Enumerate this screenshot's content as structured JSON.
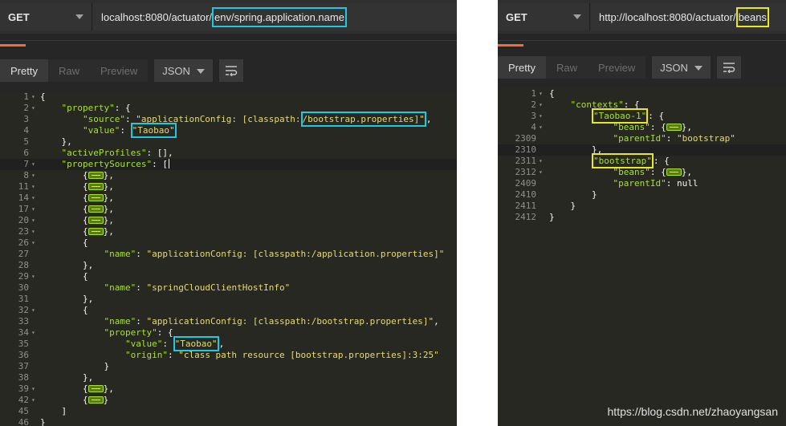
{
  "left": {
    "method": "GET",
    "url_prefix": "localhost:8080/actuator/",
    "url_highlight": "env/spring.application.name",
    "tabs": {
      "pretty": "Pretty",
      "raw": "Raw",
      "preview": "Preview"
    },
    "format": "JSON",
    "lines": [
      {
        "n": "1",
        "fold": true,
        "t": [
          [
            "p",
            "{"
          ]
        ]
      },
      {
        "n": "2",
        "fold": true,
        "t": [
          [
            "p",
            "    "
          ],
          [
            "k",
            "\"property\""
          ],
          [
            "p",
            ": {"
          ]
        ]
      },
      {
        "n": "3",
        "t": [
          [
            "p",
            "        "
          ],
          [
            "k",
            "\"source\""
          ],
          [
            "p",
            ": "
          ],
          [
            "s",
            "\"applicationConfig: [classpath:"
          ],
          [
            "sC",
            "/bootstrap.properties]\""
          ],
          [
            "p",
            ","
          ]
        ]
      },
      {
        "n": "4",
        "t": [
          [
            "p",
            "        "
          ],
          [
            "k",
            "\"value\""
          ],
          [
            "p",
            ": "
          ],
          [
            "sC",
            "\"Taobao\""
          ]
        ]
      },
      {
        "n": "5",
        "t": [
          [
            "p",
            "    },"
          ]
        ]
      },
      {
        "n": "6",
        "t": [
          [
            "p",
            "    "
          ],
          [
            "k",
            "\"activeProfiles\""
          ],
          [
            "p",
            ": [],"
          ]
        ]
      },
      {
        "n": "7",
        "fold": true,
        "cur": true,
        "t": [
          [
            "p",
            "    "
          ],
          [
            "k",
            "\"propertySources\""
          ],
          [
            "p",
            ": ["
          ],
          [
            "cur",
            ""
          ]
        ]
      },
      {
        "n": "8",
        "fold": true,
        "t": [
          [
            "p",
            "        {"
          ],
          [
            "fw",
            ""
          ],
          [
            "p",
            "},"
          ]
        ]
      },
      {
        "n": "11",
        "fold": true,
        "t": [
          [
            "p",
            "        {"
          ],
          [
            "fw",
            ""
          ],
          [
            "p",
            "},"
          ]
        ]
      },
      {
        "n": "14",
        "fold": true,
        "t": [
          [
            "p",
            "        {"
          ],
          [
            "fw",
            ""
          ],
          [
            "p",
            "},"
          ]
        ]
      },
      {
        "n": "17",
        "fold": true,
        "t": [
          [
            "p",
            "        {"
          ],
          [
            "fw",
            ""
          ],
          [
            "p",
            "},"
          ]
        ]
      },
      {
        "n": "20",
        "fold": true,
        "t": [
          [
            "p",
            "        {"
          ],
          [
            "fw",
            ""
          ],
          [
            "p",
            "},"
          ]
        ]
      },
      {
        "n": "23",
        "fold": true,
        "t": [
          [
            "p",
            "        {"
          ],
          [
            "fw",
            ""
          ],
          [
            "p",
            "},"
          ]
        ]
      },
      {
        "n": "26",
        "fold": true,
        "t": [
          [
            "p",
            "        {"
          ]
        ]
      },
      {
        "n": "27",
        "t": [
          [
            "p",
            "            "
          ],
          [
            "k",
            "\"name\""
          ],
          [
            "p",
            ": "
          ],
          [
            "s",
            "\"applicationConfig: [classpath:/application.properties]\""
          ]
        ]
      },
      {
        "n": "28",
        "t": [
          [
            "p",
            "        },"
          ]
        ]
      },
      {
        "n": "29",
        "fold": true,
        "t": [
          [
            "p",
            "        {"
          ]
        ]
      },
      {
        "n": "30",
        "t": [
          [
            "p",
            "            "
          ],
          [
            "k",
            "\"name\""
          ],
          [
            "p",
            ": "
          ],
          [
            "s",
            "\"springCloudClientHostInfo\""
          ]
        ]
      },
      {
        "n": "31",
        "t": [
          [
            "p",
            "        },"
          ]
        ]
      },
      {
        "n": "32",
        "fold": true,
        "t": [
          [
            "p",
            "        {"
          ]
        ]
      },
      {
        "n": "33",
        "t": [
          [
            "p",
            "            "
          ],
          [
            "k",
            "\"name\""
          ],
          [
            "p",
            ": "
          ],
          [
            "s",
            "\"applicationConfig: [classpath:/bootstrap.properties]\""
          ],
          [
            "p",
            ","
          ]
        ]
      },
      {
        "n": "34",
        "fold": true,
        "t": [
          [
            "p",
            "            "
          ],
          [
            "k",
            "\"property\""
          ],
          [
            "p",
            ": {"
          ]
        ]
      },
      {
        "n": "35",
        "t": [
          [
            "p",
            "                "
          ],
          [
            "k",
            "\"value\""
          ],
          [
            "p",
            ": "
          ],
          [
            "sC",
            "\"Taobao\""
          ],
          [
            "p",
            ","
          ]
        ]
      },
      {
        "n": "36",
        "t": [
          [
            "p",
            "                "
          ],
          [
            "k",
            "\"origin\""
          ],
          [
            "p",
            ": "
          ],
          [
            "s",
            "\"class path resource [bootstrap.properties]:3:25\""
          ]
        ]
      },
      {
        "n": "37",
        "t": [
          [
            "p",
            "            }"
          ]
        ]
      },
      {
        "n": "38",
        "t": [
          [
            "p",
            "        },"
          ]
        ]
      },
      {
        "n": "39",
        "fold": true,
        "t": [
          [
            "p",
            "        {"
          ],
          [
            "fw",
            ""
          ],
          [
            "p",
            "},"
          ]
        ]
      },
      {
        "n": "42",
        "fold": true,
        "t": [
          [
            "p",
            "        {"
          ],
          [
            "fw",
            ""
          ],
          [
            "p",
            "}"
          ]
        ]
      },
      {
        "n": "45",
        "t": [
          [
            "p",
            "    ]"
          ]
        ]
      },
      {
        "n": "46",
        "t": [
          [
            "p",
            "}"
          ]
        ]
      }
    ]
  },
  "right": {
    "method": "GET",
    "url_prefix": "http://localhost:8080/actuator/",
    "url_highlight": "beans",
    "tabs": {
      "pretty": "Pretty",
      "raw": "Raw",
      "preview": "Preview"
    },
    "format": "JSON",
    "lines": [
      {
        "n": "1",
        "fold": true,
        "t": [
          [
            "p",
            "{"
          ]
        ]
      },
      {
        "n": "2",
        "fold": true,
        "t": [
          [
            "p",
            "    "
          ],
          [
            "k",
            "\"contexts\""
          ],
          [
            "p",
            ": {"
          ]
        ]
      },
      {
        "n": "3",
        "fold": true,
        "t": [
          [
            "p",
            "        "
          ],
          [
            "kY",
            "\"Taobao-1\""
          ],
          [
            "p",
            ": {"
          ]
        ]
      },
      {
        "n": "4",
        "fold": true,
        "t": [
          [
            "p",
            "            "
          ],
          [
            "k",
            "\"beans\""
          ],
          [
            "p",
            ": {"
          ],
          [
            "fw",
            ""
          ],
          [
            "p",
            "},"
          ]
        ]
      },
      {
        "n": "2309",
        "t": [
          [
            "p",
            "            "
          ],
          [
            "k",
            "\"parentId\""
          ],
          [
            "p",
            ": "
          ],
          [
            "s",
            "\"bootstrap\""
          ]
        ]
      },
      {
        "n": "2310",
        "cur": true,
        "t": [
          [
            "p",
            "        },"
          ]
        ]
      },
      {
        "n": "2311",
        "fold": true,
        "t": [
          [
            "p",
            "        "
          ],
          [
            "kY",
            "\"bootstrap\""
          ],
          [
            "p",
            ": {"
          ]
        ]
      },
      {
        "n": "2312",
        "fold": true,
        "t": [
          [
            "p",
            "            "
          ],
          [
            "k",
            "\"beans\""
          ],
          [
            "p",
            ": {"
          ],
          [
            "fw",
            ""
          ],
          [
            "p",
            "},"
          ]
        ]
      },
      {
        "n": "2409",
        "t": [
          [
            "p",
            "            "
          ],
          [
            "k",
            "\"parentId\""
          ],
          [
            "p",
            ": null"
          ]
        ]
      },
      {
        "n": "2410",
        "t": [
          [
            "p",
            "        }"
          ]
        ]
      },
      {
        "n": "2411",
        "t": [
          [
            "p",
            "    }"
          ]
        ]
      },
      {
        "n": "2412",
        "t": [
          [
            "p",
            "}"
          ]
        ]
      }
    ]
  },
  "watermark": "https://blog.csdn.net/zhaoyangsan",
  "colors": {
    "key": "#a6e22e",
    "string": "#e6db74",
    "cyan_highlight": "#22c7e0",
    "yellow_highlight": "#e8e81b",
    "accent": "#f26b3a"
  },
  "icons": {
    "wrap": "wrap-lines-icon",
    "dropdown": "chevron-down-icon"
  }
}
